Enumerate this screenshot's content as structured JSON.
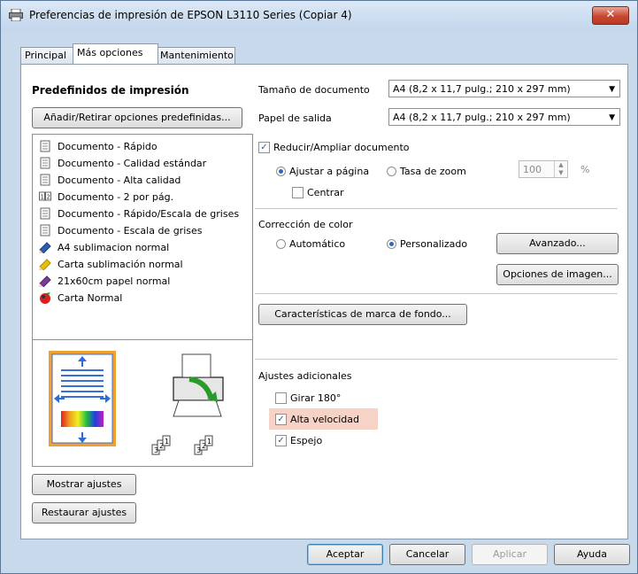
{
  "window": {
    "title": "Preferencias de impresión de EPSON L3110 Series (Copiar 4)",
    "close_label": "✕"
  },
  "tabs": [
    {
      "label": "Principal"
    },
    {
      "label": "Más opciones"
    },
    {
      "label": "Mantenimiento"
    }
  ],
  "presets": {
    "heading": "Predefinidos de impresión",
    "add_remove_button": "Añadir/Retirar opciones predefinidas...",
    "items": [
      {
        "label": "Documento - Rápido",
        "icon": "document-icon"
      },
      {
        "label": "Documento - Calidad estándar",
        "icon": "document-icon"
      },
      {
        "label": "Documento - Alta calidad",
        "icon": "document-icon"
      },
      {
        "label": "Documento - 2 por pág.",
        "icon": "two-pages-icon"
      },
      {
        "label": "Documento - Rápido/Escala de grises",
        "icon": "document-icon"
      },
      {
        "label": "Documento - Escala de grises",
        "icon": "document-icon"
      },
      {
        "label": "A4 sublimacion normal",
        "icon": "pencil-icon",
        "color": "#2a5fb0"
      },
      {
        "label": "Carta sublimación normal",
        "icon": "pencil-icon",
        "color": "#e8c200"
      },
      {
        "label": "21x60cm papel normal",
        "icon": "pencil-icon",
        "color": "#7a3a9a"
      },
      {
        "label": "Carta Normal",
        "icon": "colorful-icon",
        "color": "#d82020"
      }
    ]
  },
  "page_icons": {
    "a": "321",
    "b": "321"
  },
  "left_buttons": {
    "show": "Mostrar ajustes",
    "restore": "Restaurar ajustes"
  },
  "document": {
    "size_label": "Tamaño de documento",
    "size_value": "A4 (8,2 x 11,7 pulg.; 210 x 297 mm)",
    "output_label": "Papel de salida",
    "output_value": "A4 (8,2 x 11,7 pulg.; 210 x 297 mm)",
    "reduce_label": "Reducir/Ampliar documento",
    "fit_label": "Ajustar a página",
    "zoom_label": "Tasa de zoom",
    "zoom_value": "100",
    "zoom_unit": "%",
    "center_label": "Centrar"
  },
  "color": {
    "heading": "Corrección de color",
    "auto_label": "Automático",
    "custom_label": "Personalizado",
    "advanced_button": "Avanzado...",
    "image_options_button": "Opciones de imagen..."
  },
  "watermark_button": "Características de marca de fondo...",
  "extra": {
    "heading": "Ajustes adicionales",
    "rotate_label": "Girar 180°",
    "high_speed_label": "Alta velocidad",
    "mirror_label": "Espejo"
  },
  "footer": {
    "accept": "Aceptar",
    "cancel": "Cancelar",
    "apply": "Aplicar",
    "help": "Ayuda"
  },
  "colors": {
    "accent": "#2c6ab1",
    "highlight": "#f6d3c6",
    "window_bg": "#c8d9ec"
  }
}
